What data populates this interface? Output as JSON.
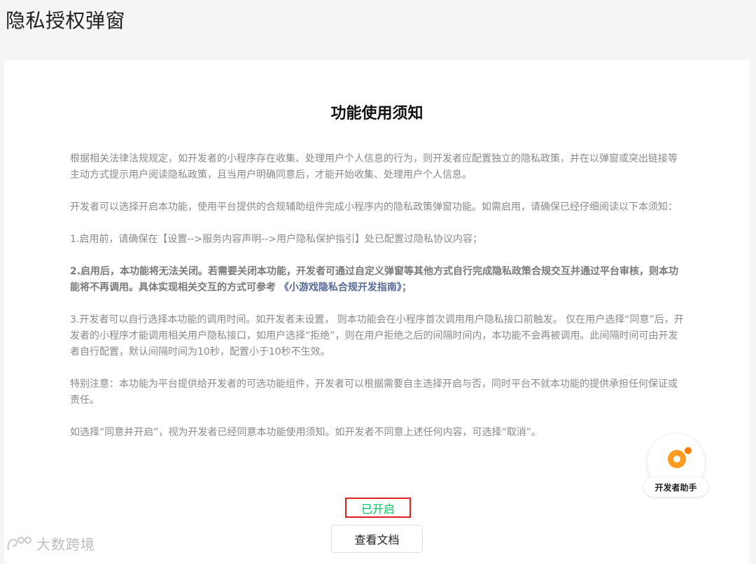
{
  "page": {
    "title": "隐私授权弹窗"
  },
  "notice": {
    "title": "功能使用须知",
    "p1": "根据相关法律法规规定，如开发者的小程序存在收集、处理用户个人信息的行为，则开发者应配置独立的隐私政策，并在以弹窗或突出链接等主动方式提示用户阅读隐私政策，且当用户明确同意后，才能开始收集、处理用户个人信息。",
    "p2": "开发者可以选择开启本功能，使用平台提供的合规辅助组件完成小程序内的隐私政策弹窗功能。如需启用，请确保已经仔细阅读以下本须知：",
    "p3": "1.启用前，请确保在【设置-->服务内容声明-->用户隐私保护指引】处已配置过隐私协议内容；",
    "p4_text": "2.启用后，本功能将无法关闭。若需要关闭本功能，开发者可通过自定义弹窗等其他方式自行完成隐私政策合规交互并通过平台审核，则本功能将不再调用。具体实现相关交互的方式可参考",
    "p4_link": " 《小游戏隐私合规开发指南》",
    "p4_end": "；",
    "p5": "3.开发者可以自行选择本功能的调用时间。如开发者未设置， 则本功能会在小程序首次调用用户隐私接口前触发。 仅在用户选择“同意”后，开发者的小程序才能调用相关用户隐私接口，如用户选择“拒绝”，则在用户拒绝之后的间隔时间内，本功能不会再被调用。此间隔时间可由开发者自行配置，默认间隔时间为10秒，配置小于10秒不生效。",
    "p6": "特别注意：本功能为平台提供给开发者的可选功能组件，开发者可以根据需要自主选择开启与否，同时平台不就本功能的提供承担任何保证或责任。",
    "p7": "如选择“同意并开启”，视为开发者已经同意本功能使用须知。如开发者不同意上述任何内容，可选择“取消”。"
  },
  "status": {
    "label": "已开启",
    "color": "#07c160",
    "highlight_color": "#e02020"
  },
  "actions": {
    "view_docs": "查看文档"
  },
  "assistant": {
    "label": "开发者助手",
    "icon": "assistant-icon",
    "accent": "#ff8a00"
  },
  "watermark": {
    "text": "大数跨境"
  }
}
